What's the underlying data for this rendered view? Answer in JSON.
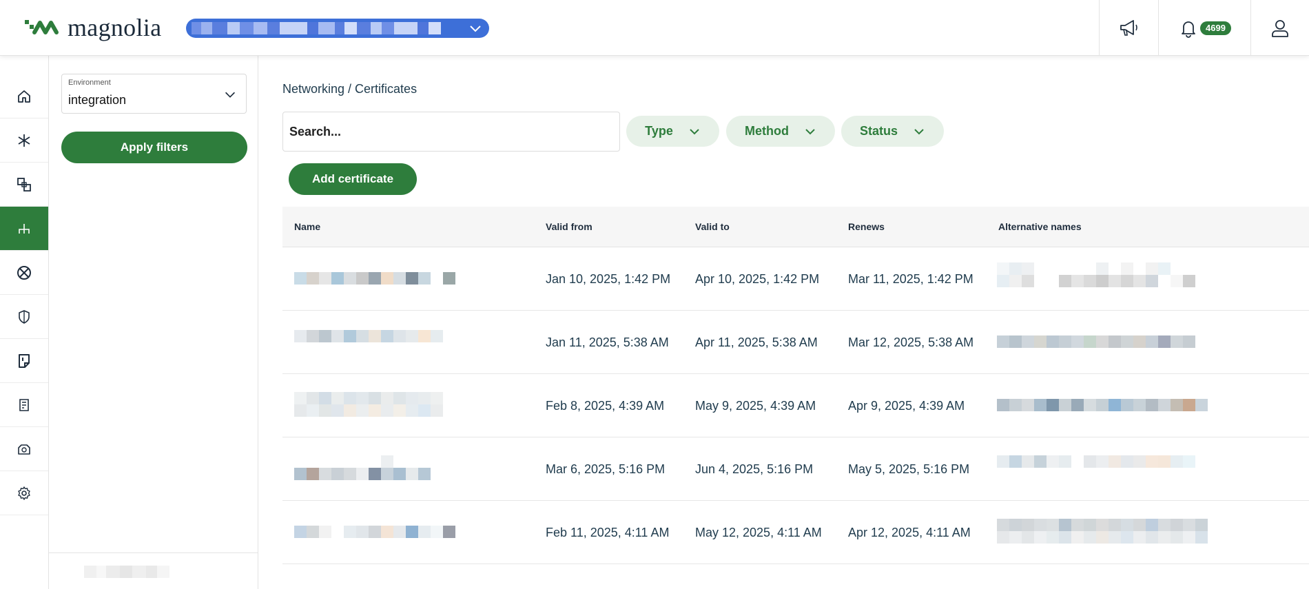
{
  "app": {
    "logo_text": "magnolia"
  },
  "header": {
    "org_selector_value": "",
    "notifications_count": "4699"
  },
  "rail": {
    "items": [
      {
        "name": "home-icon",
        "active": false
      },
      {
        "name": "asterisk-icon",
        "active": false
      },
      {
        "name": "squares-link-icon",
        "active": false
      },
      {
        "name": "network-icon",
        "active": true
      },
      {
        "name": "globe-icon",
        "active": false
      },
      {
        "name": "shield-icon",
        "active": false
      },
      {
        "name": "document-icon",
        "active": false
      },
      {
        "name": "logs-icon",
        "active": false
      },
      {
        "name": "backup-icon",
        "active": false
      },
      {
        "name": "gear-icon",
        "active": false
      }
    ]
  },
  "filters": {
    "environment_label": "Environment",
    "environment_value": "integration",
    "apply_label": "Apply filters"
  },
  "main": {
    "breadcrumb": "Networking / Certificates",
    "search_placeholder": "Search...",
    "chips": [
      "Type",
      "Method",
      "Status"
    ],
    "add_label": "Add certificate"
  },
  "table": {
    "columns": [
      "Name",
      "Valid from",
      "Valid to",
      "Renews",
      "Alternative names"
    ],
    "rows": [
      {
        "valid_from": "Jan 10, 2025, 1:42 PM",
        "valid_to": "Apr 10, 2025, 1:42 PM",
        "renews": "Mar 11, 2025, 1:42 PM"
      },
      {
        "valid_from": "Jan 11, 2025, 5:38 AM",
        "valid_to": "Apr 11, 2025, 5:38 AM",
        "renews": "Mar 12, 2025, 5:38 AM"
      },
      {
        "valid_from": "Feb 8, 2025, 4:39 AM",
        "valid_to": "May 9, 2025, 4:39 AM",
        "renews": "Apr 9, 2025, 4:39 AM"
      },
      {
        "valid_from": "Mar 6, 2025, 5:16 PM",
        "valid_to": "Jun 4, 2025, 5:16 PM",
        "renews": "May 5, 2025, 5:16 PM"
      },
      {
        "valid_from": "Feb 11, 2025, 4:11 AM",
        "valid_to": "May 12, 2025, 4:11 AM",
        "renews": "Apr 12, 2025, 4:11 AM"
      }
    ]
  },
  "colors": {
    "brand_green": "#2e7d3c",
    "chip_bg": "#e7f1e8",
    "org_selector_blue": "#3d6fd8"
  }
}
